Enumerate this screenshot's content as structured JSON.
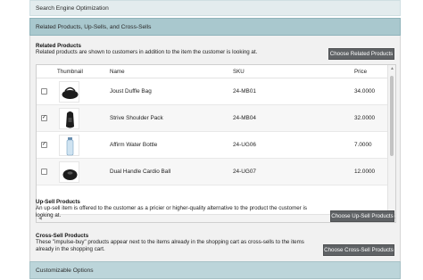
{
  "sections": {
    "seo": "Search Engine Optimization",
    "related_upsells_crosssells": "Related Products, Up-Sells, and Cross-Sells",
    "customizable_options": "Customizable Options"
  },
  "related": {
    "title": "Related Products",
    "description": "Related products are shown to customers in addition to the item the customer is looking at.",
    "button": "Choose Related Products",
    "columns": {
      "thumbnail": "Thumbnail",
      "name": "Name",
      "sku": "SKU",
      "price": "Price"
    },
    "rows": [
      {
        "checked": false,
        "thumbnail": "duffle-bag-image",
        "name": "Joust Duffle Bag",
        "sku": "24-MB01",
        "price": "34.0000"
      },
      {
        "checked": true,
        "thumbnail": "backpack-image",
        "name": "Strive Shoulder Pack",
        "sku": "24-MB04",
        "price": "32.0000"
      },
      {
        "checked": true,
        "thumbnail": "water-bottle-image",
        "name": "Affirm Water Bottle",
        "sku": "24-UG06",
        "price": "7.0000"
      },
      {
        "checked": false,
        "thumbnail": "kettlebell-ball-image",
        "name": "Dual Handle Cardio Ball",
        "sku": "24-UG07",
        "price": "12.0000"
      }
    ]
  },
  "upsell": {
    "title": "Up-Sell Products",
    "description": "An up-sell item is offered to the customer as a pricier or higher-quality alternative to the product the customer is looking at.",
    "button": "Choose Up-Sell Products"
  },
  "crosssell": {
    "title": "Cross-Sell Products",
    "description": "These \"impulse-buy\" products appear next to the items already in the shopping cart as cross-sells to the items already in the shopping cart.",
    "button": "Choose Cross-Sell Products"
  },
  "colors": {
    "section_header": "#a9c8ce",
    "button_bg": "#5f6265",
    "panel_bg": "#f1f1f1"
  }
}
